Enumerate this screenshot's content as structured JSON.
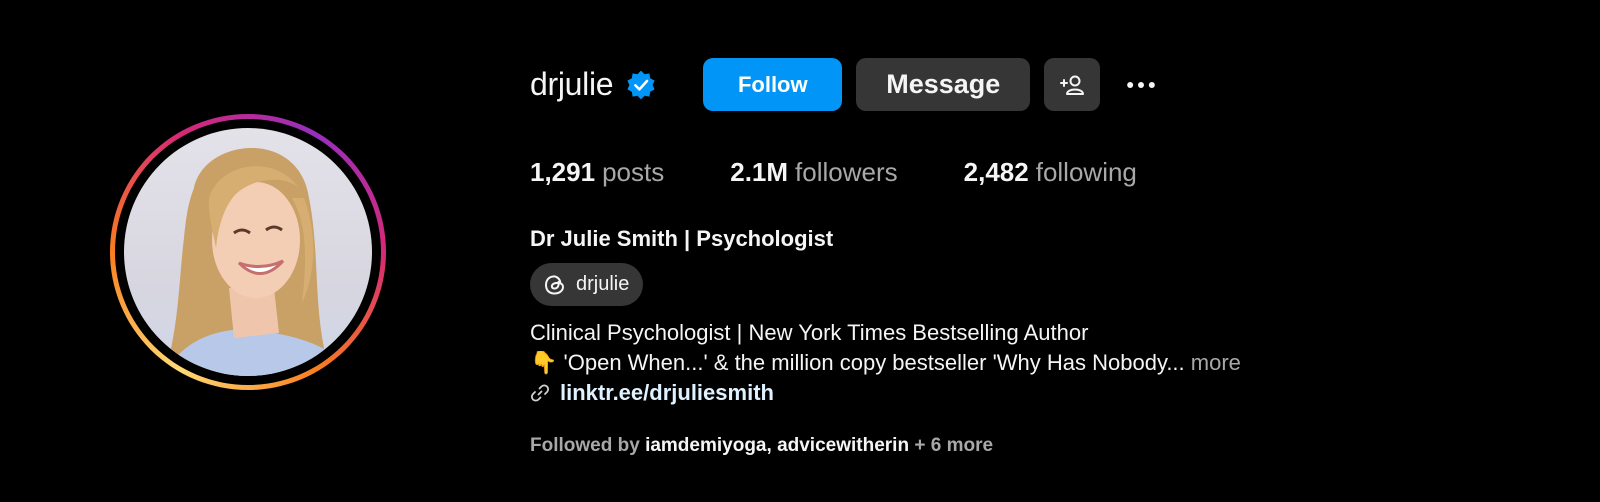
{
  "profile": {
    "username": "drjulie",
    "verified": true,
    "full_name": "Dr Julie Smith | Psychologist"
  },
  "actions": {
    "follow_label": "Follow",
    "message_label": "Message",
    "add_user_icon": "add-user-icon",
    "more_icon": "more-horizontal-icon"
  },
  "stats": [
    {
      "value": "1,291",
      "label": "posts"
    },
    {
      "value": "2.1M",
      "label": "followers"
    },
    {
      "value": "2,482",
      "label": "following"
    }
  ],
  "threads": {
    "handle": "drjulie",
    "icon": "threads-icon"
  },
  "bio": {
    "line1": "Clinical Psychologist | New York Times Bestselling Author",
    "line2_emoji": "👇",
    "line2_text": "'Open When...' & the million copy bestseller 'Why Has Nobody...",
    "more_label": "more",
    "link_text": "linktr.ee/drjuliesmith",
    "link_icon": "link-icon"
  },
  "followed_by": {
    "prefix": "Followed by",
    "users": [
      "iamdemiyoga",
      "advicewitherin"
    ],
    "suffix": "+ 6 more"
  },
  "colors": {
    "background": "#000000",
    "follow_button": "#0095f6",
    "secondary_button": "#363636",
    "verified_badge": "#0095f6",
    "link": "#e0f1ff",
    "muted_text": "#a8a8a8"
  }
}
